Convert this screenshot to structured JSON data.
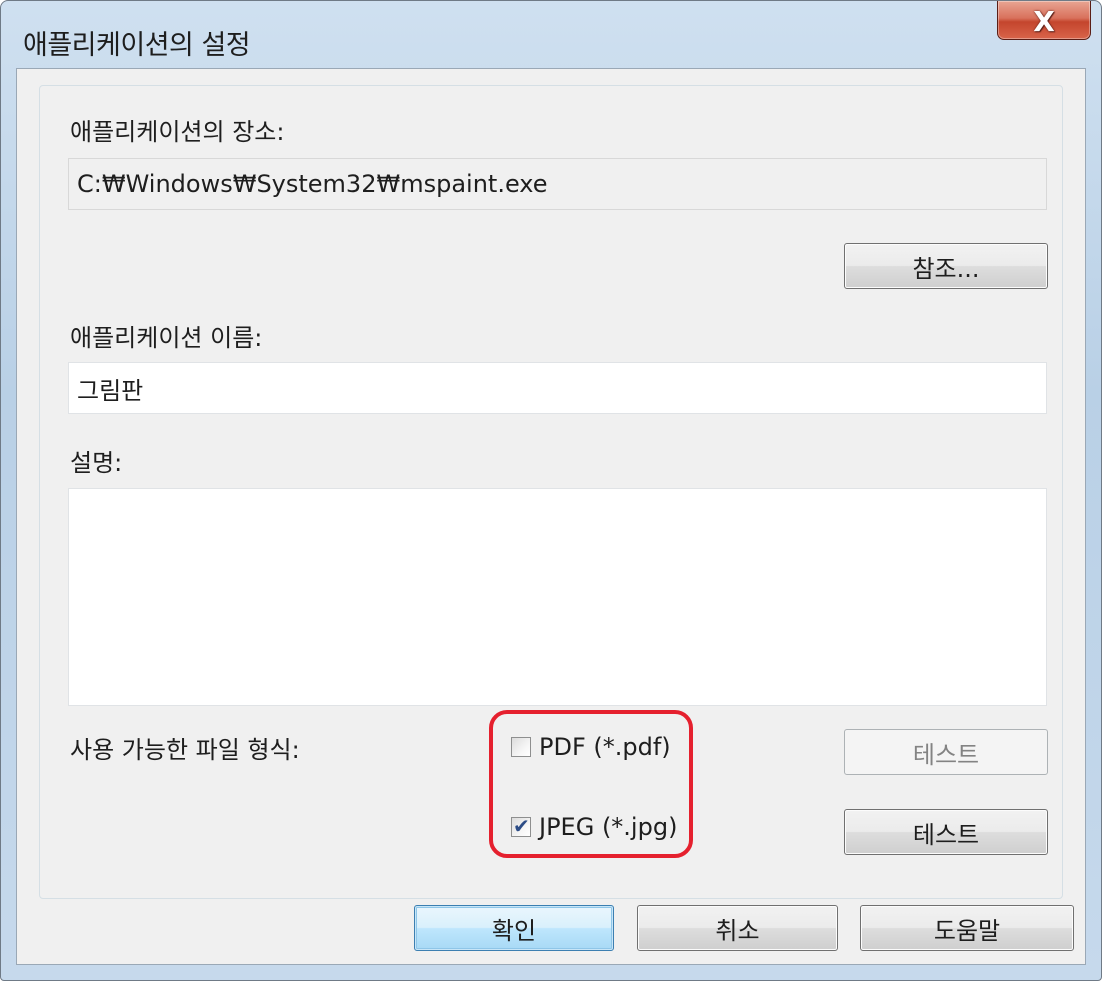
{
  "window": {
    "title": "애플리케이션의 설정",
    "close_glyph": "X"
  },
  "location": {
    "label": "애플리케이션의 장소:",
    "value": "C:₩Windows₩System32₩mspaint.exe",
    "browse_label": "참조..."
  },
  "name": {
    "label": "애플리케이션 이름:",
    "value": "그림판"
  },
  "description": {
    "label": "설명:",
    "value": ""
  },
  "formats": {
    "label": "사용 가능한 파일 형식:",
    "pdf": {
      "label": "PDF (*.pdf)",
      "checked": false,
      "test_label": "테스트",
      "test_enabled": false
    },
    "jpeg": {
      "label": "JPEG (*.jpg)",
      "checked": true,
      "test_label": "테스트",
      "test_enabled": true
    }
  },
  "footer": {
    "ok_label": "확인",
    "cancel_label": "취소",
    "help_label": "도움말"
  },
  "colors": {
    "highlight": "#e5202e",
    "check_mark": "#2c4c86"
  },
  "icons": {
    "close": "close-icon",
    "check": "check-mark-icon"
  }
}
